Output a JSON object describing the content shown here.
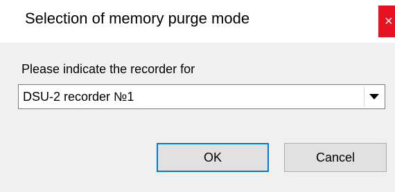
{
  "window": {
    "title": "Selection of memory purge mode",
    "close_glyph": "×"
  },
  "form": {
    "prompt": "Please indicate the recorder for",
    "recorder_select": {
      "selected_value": "DSU-2 recorder №1",
      "arrow_icon": "chevron-down-icon"
    }
  },
  "buttons": {
    "ok_label": "OK",
    "cancel_label": "Cancel"
  },
  "colors": {
    "close_button": "#e81123",
    "dialog_background": "#f0f0f0",
    "default_button_border": "#0078d7"
  }
}
